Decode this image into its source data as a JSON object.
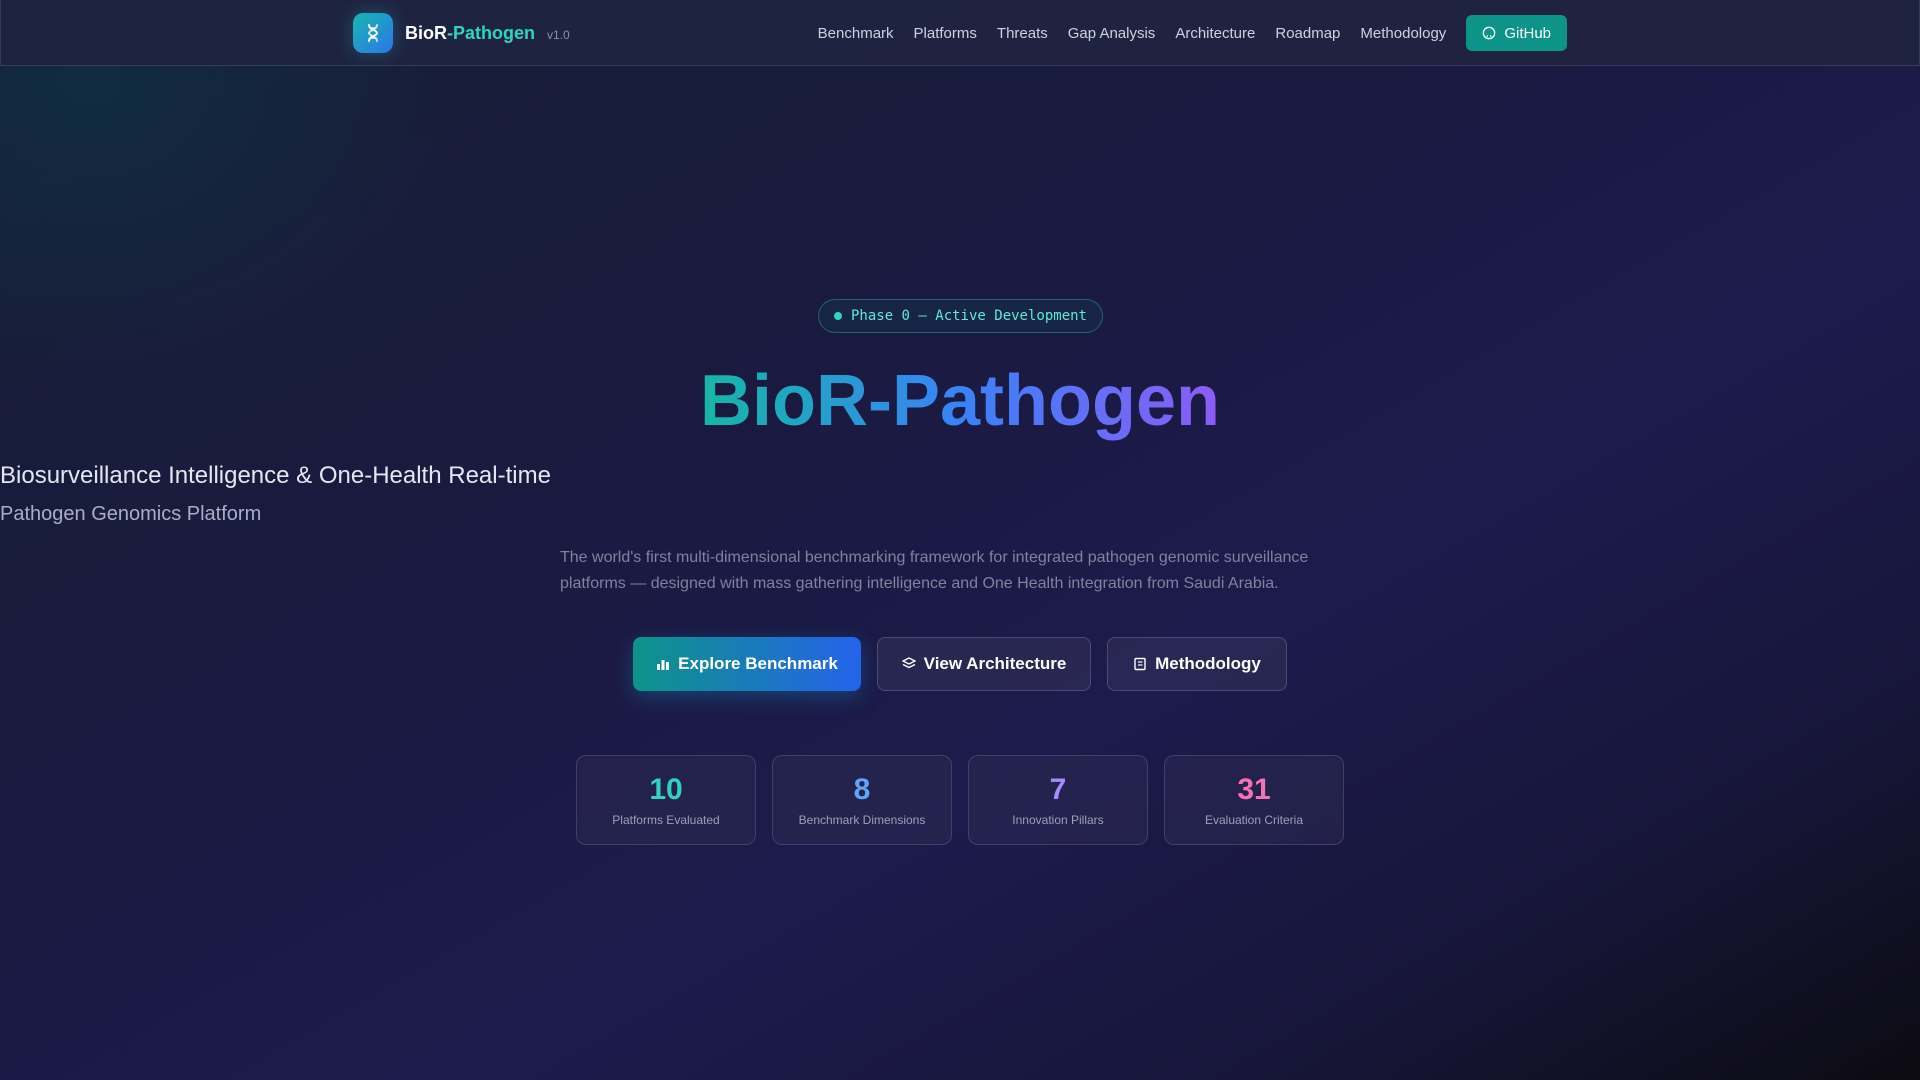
{
  "brand": {
    "name_primary": "BioR",
    "name_accent": "-Pathogen",
    "version": "v1.0",
    "logo_icon": "dna-icon"
  },
  "nav": {
    "links": [
      "Benchmark",
      "Platforms",
      "Threats",
      "Gap Analysis",
      "Architecture",
      "Roadmap",
      "Methodology"
    ],
    "github_label": "GitHub",
    "github_icon": "github-icon"
  },
  "hero": {
    "badge": "Phase 0 — Active Development",
    "title": "BioR-Pathogen",
    "subtitle": "Biosurveillance Intelligence & One-Health Real-time",
    "subtitle2": "Pathogen Genomics Platform",
    "description": "The world's first multi-dimensional benchmarking framework for integrated pathogen genomic surveillance platforms — designed with mass gathering intelligence and One Health integration from Saudi Arabia.",
    "buttons": {
      "explore": "Explore Benchmark",
      "architecture": "View Architecture",
      "methodology": "Methodology"
    }
  },
  "stats": [
    {
      "value": "10",
      "label": "Platforms Evaluated",
      "color": "#2dd4bf"
    },
    {
      "value": "8",
      "label": "Benchmark Dimensions",
      "color": "#60a5fa"
    },
    {
      "value": "7",
      "label": "Innovation Pillars",
      "color": "#a78bfa"
    },
    {
      "value": "31",
      "label": "Evaluation Criteria",
      "color": "#f472b6"
    }
  ],
  "colors": {
    "accent_teal": "#2dd4bf",
    "button_teal": "#0d9488",
    "accent_blue": "#2563eb",
    "accent_violet": "#8b5cf6"
  }
}
